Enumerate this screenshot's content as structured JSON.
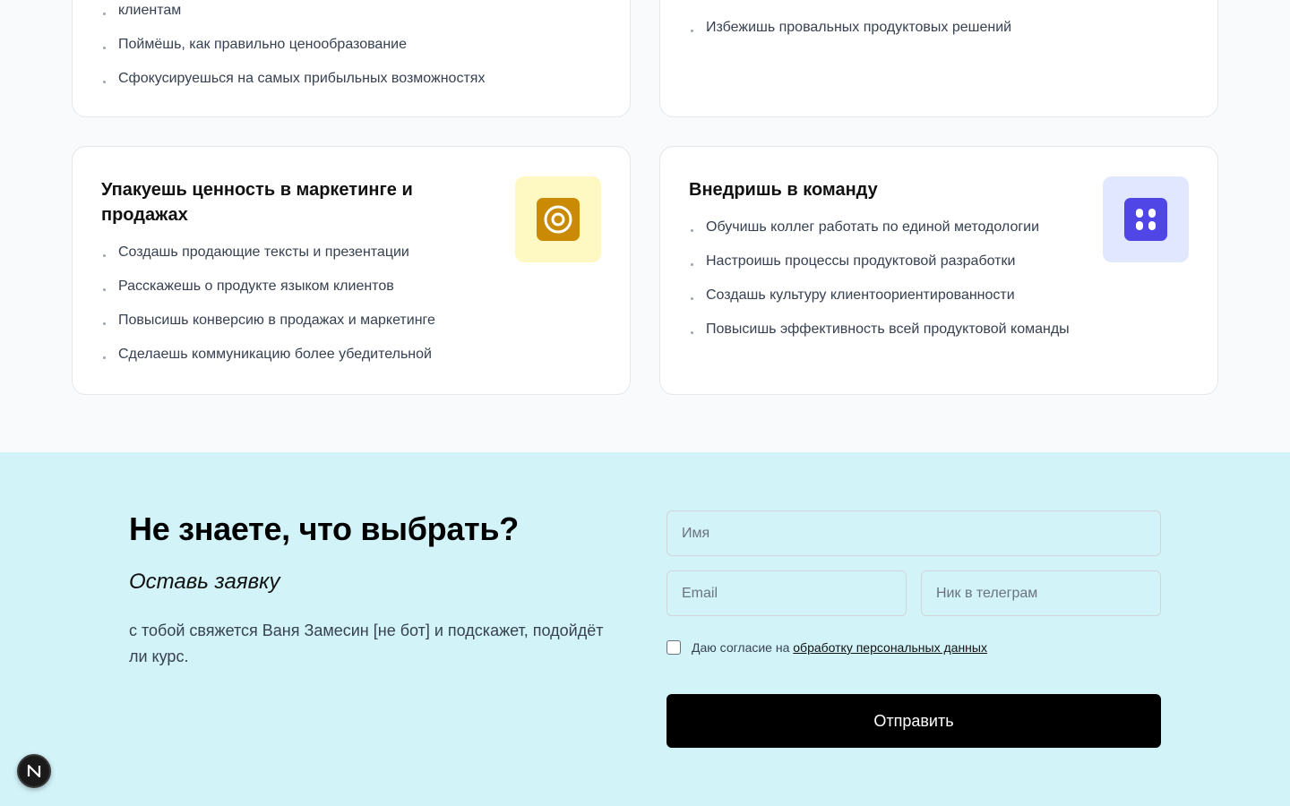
{
  "cards": {
    "top_left": {
      "items": [
        "клиентам",
        "Поймёшь, как правильно ценообразование",
        "Сфокусируешься на самых прибыльных возможностях"
      ]
    },
    "top_right": {
      "items": [
        "Избежишь провальных продуктовых решений"
      ]
    },
    "bottom_left": {
      "title": "Упакуешь ценность в маркетинге и продажах",
      "icon": "target-icon",
      "icon_bg": "#fef9c3",
      "icon_color": "#ca8a04",
      "items": [
        "Создашь продающие тексты и презентации",
        "Расскажешь о продукте языком клиентов",
        "Повысишь конверсию в продажах и маркетинге",
        "Сделаешь коммуникацию более убедительной"
      ]
    },
    "bottom_right": {
      "title": "Внедришь в команду",
      "icon": "team-grid-icon",
      "icon_bg": "#e0e7ff",
      "icon_color": "#4f46e5",
      "items": [
        "Обучишь коллег работать по единой методологии",
        "Настроишь процессы продуктовой разработки",
        "Создашь культуру клиентоориентированности",
        "Повысишь эффективность всей продуктовой команды"
      ]
    }
  },
  "lead": {
    "title": "Не знаете, что выбрать?",
    "subtitle": "Оставь заявку",
    "text": "с тобой свяжется Ваня Замесин [не бот] и подскажет, подойдёт ли курс.",
    "name_placeholder": "Имя",
    "email_placeholder": "Email",
    "telegram_placeholder": "Ник в телеграм",
    "consent_prefix": "Даю согласие на",
    "consent_link": "обработку персональных данных",
    "submit_label": "Отправить",
    "background": "#d2f4f9"
  },
  "fab": {
    "label": "N"
  }
}
